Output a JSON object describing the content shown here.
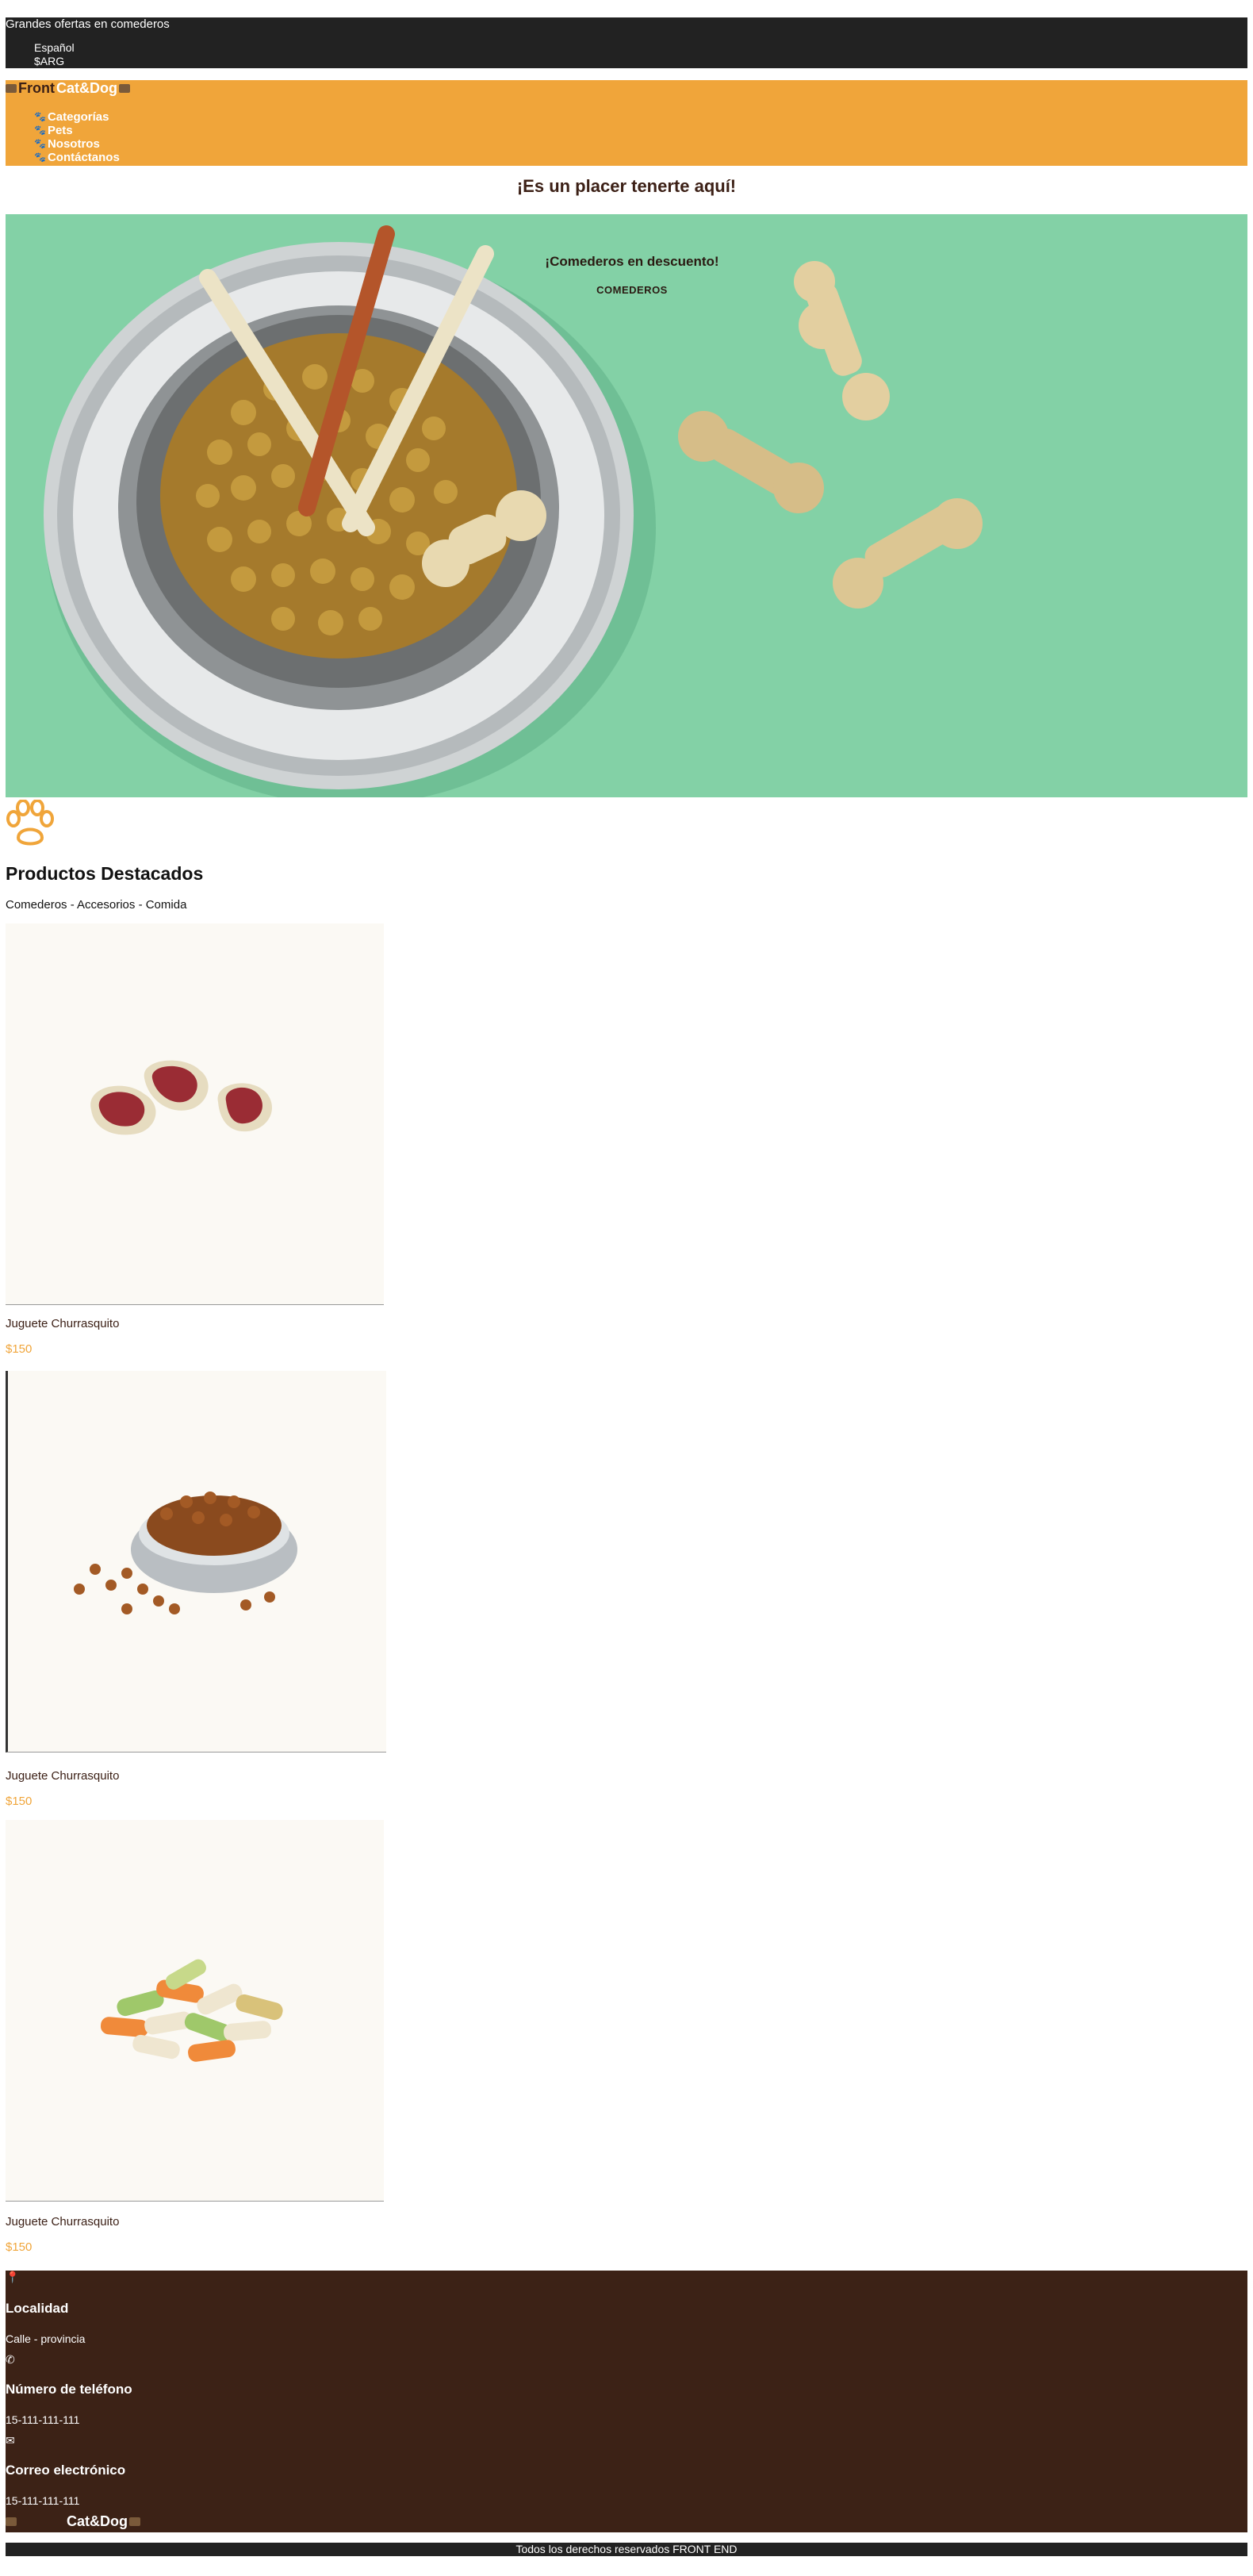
{
  "topbar": {
    "promo": "Grandes ofertas en comederos",
    "language": "Español",
    "currency": "$ARG"
  },
  "header": {
    "brand_front": "Front",
    "brand_catdog": "Cat&Dog",
    "nav": [
      "Categorías",
      "Pets",
      "Nosotros",
      "Contáctanos"
    ]
  },
  "welcome": "¡Es un placer tenerte aquí!",
  "hero": {
    "title": "¡Comederos en descuento!",
    "button": "COMEDEROS"
  },
  "featured": {
    "title": "Productos Destacados",
    "subtitle": "Comederos - Accesorios - Comida",
    "products": [
      {
        "name": "Juguete Churrasquito",
        "price": "$150"
      },
      {
        "name": "Juguete Churrasquito",
        "price": "$150"
      },
      {
        "name": "Juguete Churrasquito",
        "price": "$150"
      }
    ]
  },
  "footer": {
    "location_label": "Localidad",
    "location_value": "Calle - provincia",
    "phone_label": "Número de teléfono",
    "phone_value": "15-111-111-111",
    "email_label": "Correo electrónico",
    "email_value": "15-111-111-111",
    "brand": "Cat&Dog",
    "copyright": "Todos los derechos reservados FRONT END"
  },
  "colors": {
    "accent": "#f0a53a",
    "dark": "#222222",
    "brown": "#3c2216",
    "hero_bg": "#83d1a6"
  }
}
